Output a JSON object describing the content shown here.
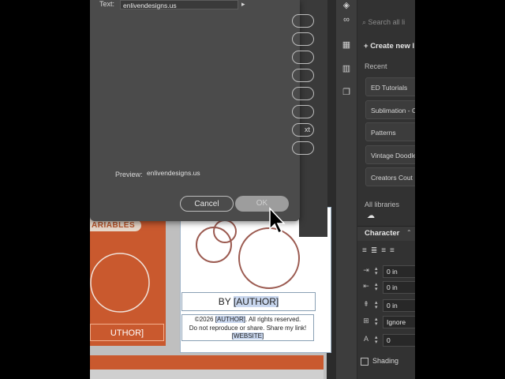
{
  "dialog": {
    "text_label": "Text:",
    "text_value": "enlivendesigns.us",
    "preview_label": "Preview:",
    "preview_value": "enlivendesigns.us",
    "pill_text": "xt",
    "cancel_label": "Cancel",
    "ok_label": "OK"
  },
  "document": {
    "variables_tag": "ARIABLES",
    "by_author_prefix": "BY ",
    "by_author_var": "[AUTHOR]",
    "copyright_line1_prefix": "©2026 ",
    "copyright_line1_var": "[AUTHOR]",
    "copyright_line1_suffix": ". All rights reserved.",
    "copyright_line2": "Do not reproduce or share. Share my link!",
    "copyright_line3": "[WEBSITE]",
    "orange_author": "UTHOR]"
  },
  "libraries": {
    "search_placeholder": "Search all li",
    "create_label": "Create new l",
    "recent_label": "Recent",
    "items": [
      "ED Tutorials",
      "Sublimation - C",
      "Patterns",
      "Vintage Doodle",
      "Creators Cout"
    ],
    "all_libraries_label": "All libraries"
  },
  "character": {
    "title": "Character",
    "fields": [
      "0 in",
      "0 in",
      "0 in",
      "Ignore",
      "0"
    ],
    "shading_label": "Shading"
  },
  "colors": {
    "accent_orange": "#c9592e",
    "panel_bg": "#323232",
    "dialog_bg": "#4b4b4b"
  }
}
